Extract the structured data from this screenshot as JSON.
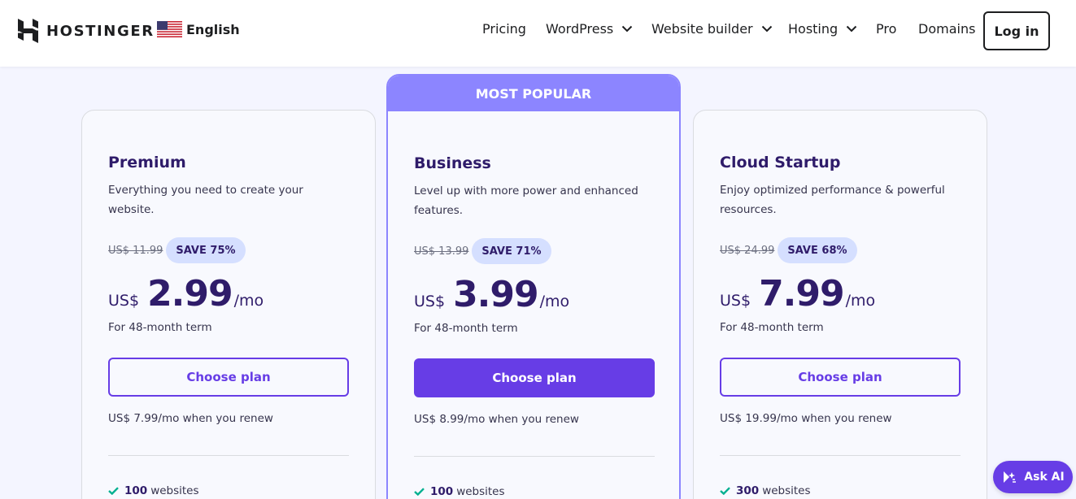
{
  "header": {
    "brand": "HOSTINGER",
    "language": "English",
    "nav": [
      {
        "label": "Pricing",
        "dropdown": false
      },
      {
        "label": "WordPress",
        "dropdown": true
      },
      {
        "label": "Website builder",
        "dropdown": true
      },
      {
        "label": "Hosting",
        "dropdown": true
      },
      {
        "label": "Pro",
        "dropdown": false
      },
      {
        "label": "Domains",
        "dropdown": false
      }
    ],
    "login_label": "Log in"
  },
  "plans": [
    {
      "name": "Premium",
      "description": "Everything you need to create your website.",
      "old_price": "US$ 11.99",
      "save": "SAVE 75%",
      "currency": "US$",
      "price": "2.99",
      "period": "/mo",
      "term": "For 48-month term",
      "cta": "Choose plan",
      "renew": "US$ 7.99/mo when you renew",
      "feature_count": "100",
      "feature_label": "websites"
    },
    {
      "badge": "MOST POPULAR",
      "name": "Business",
      "description": "Level up with more power and enhanced features.",
      "old_price": "US$ 13.99",
      "save": "SAVE 71%",
      "currency": "US$",
      "price": "3.99",
      "period": "/mo",
      "term": "For 48-month term",
      "cta": "Choose plan",
      "renew": "US$ 8.99/mo when you renew",
      "feature_count": "100",
      "feature_label": "websites"
    },
    {
      "name": "Cloud Startup",
      "description": "Enjoy optimized performance & powerful resources.",
      "old_price": "US$ 24.99",
      "save": "SAVE 68%",
      "currency": "US$",
      "price": "7.99",
      "period": "/mo",
      "term": "For 48-month term",
      "cta": "Choose plan",
      "renew": "US$ 19.99/mo when you renew",
      "feature_count": "300",
      "feature_label": "websites"
    }
  ],
  "ask_ai_label": "Ask AI",
  "colors": {
    "primary": "#673de6",
    "popular_band": "#8c85ff",
    "text_dark": "#2f1c6a",
    "page_background": "#f4f5ff",
    "save_badge": "#d5dfff",
    "check": "#00b090"
  },
  "icons": [
    "hostinger-logo-icon",
    "us-flag-icon",
    "chevron-down-icon",
    "check-icon",
    "ask-ai-sparkle-icon"
  ]
}
